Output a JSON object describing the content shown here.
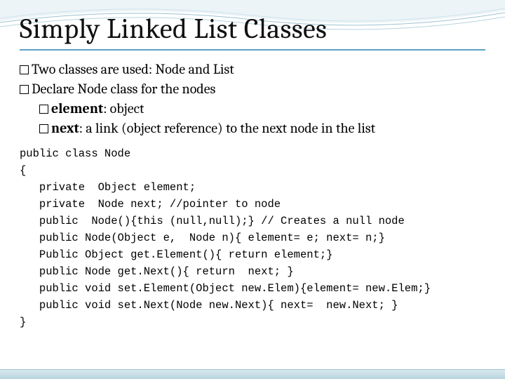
{
  "title": "Simply Linked List Classes",
  "bullets": {
    "b1": "Two classes are used: Node and List",
    "b2": "Declare Node class for the nodes",
    "s1_bold": "element",
    "s1_rest": ": object",
    "s2_bold": "next",
    "s2_rest": ": a link (object reference) to the next node in the list"
  },
  "code": "public class Node\n{\n   private  Object element;\n   private  Node next; //pointer to node\n   public  Node(){this (null,null);} // Creates a null node\n   public Node(Object e,  Node n){ element= e; next= n;}\n   Public Object get.Element(){ return element;}\n   public Node get.Next(){ return  next; }\n   public void set.Element(Object new.Elem){element= new.Elem;}\n   public void set.Next(Node new.Next){ next=  new.Next; }\n}"
}
